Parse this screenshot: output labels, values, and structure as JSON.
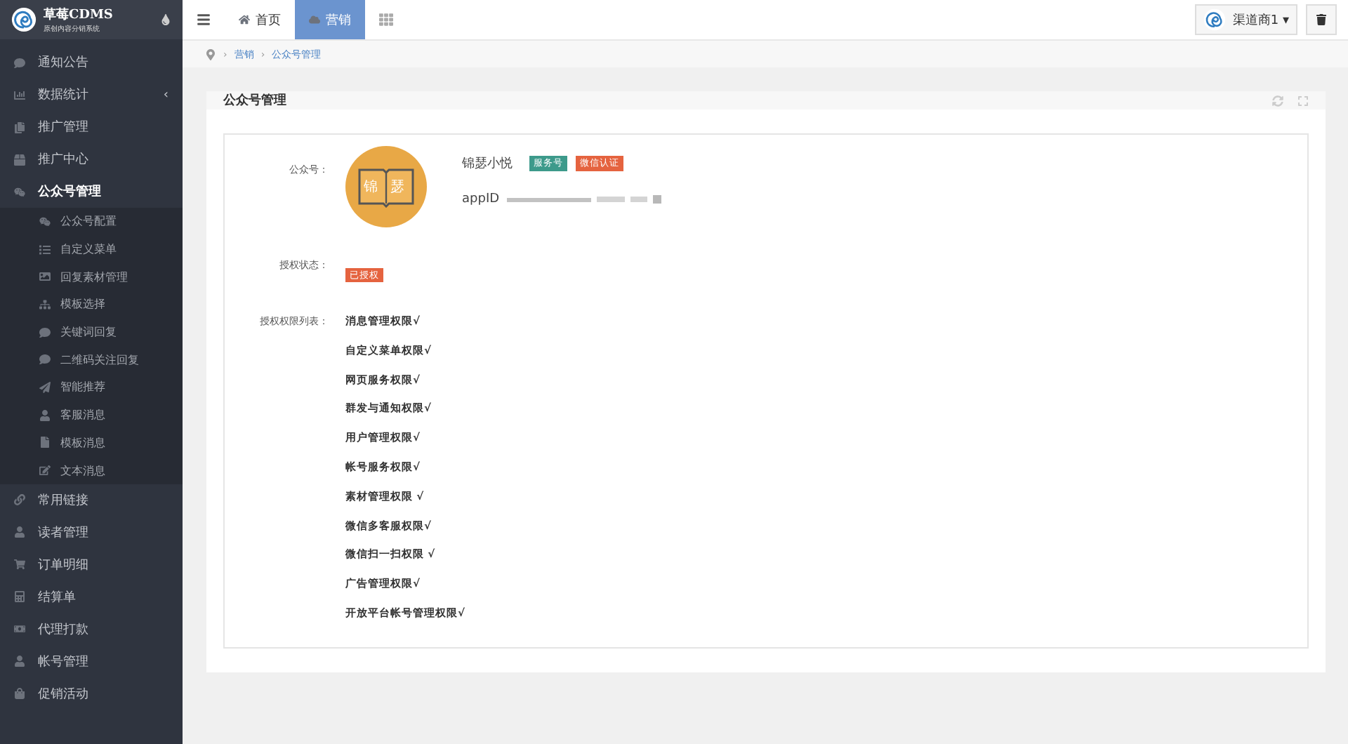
{
  "brand": {
    "title": "草莓CDMS",
    "subtitle": "原创内容分销系统"
  },
  "sidebar": {
    "items": [
      {
        "label": "通知公告",
        "selected": false
      },
      {
        "label": "数据统计",
        "selected": false,
        "caret": "‹"
      },
      {
        "label": "推广管理",
        "selected": false
      },
      {
        "label": "推广中心",
        "selected": false
      },
      {
        "label": "公众号管理",
        "selected": true,
        "children": [
          {
            "label": "公众号配置"
          },
          {
            "label": "自定义菜单"
          },
          {
            "label": "回复素材管理"
          },
          {
            "label": "模板选择"
          },
          {
            "label": "关键词回复"
          },
          {
            "label": "二维码关注回复"
          },
          {
            "label": "智能推荐"
          },
          {
            "label": "客服消息"
          },
          {
            "label": "模板消息"
          },
          {
            "label": "文本消息"
          }
        ]
      },
      {
        "label": "常用链接",
        "selected": false
      },
      {
        "label": "读者管理",
        "selected": false
      },
      {
        "label": "订单明细",
        "selected": false
      },
      {
        "label": "结算单",
        "selected": false
      },
      {
        "label": "代理打款",
        "selected": false
      },
      {
        "label": "帐号管理",
        "selected": false
      },
      {
        "label": "促销活动",
        "selected": false
      }
    ]
  },
  "tabs": [
    {
      "label": "首页",
      "selected": false
    },
    {
      "label": "营销",
      "selected": true
    }
  ],
  "user": {
    "name": "渠道商1",
    "caret": "▾"
  },
  "breadcrumb": {
    "separator": "›",
    "items": [
      "营销",
      "公众号管理"
    ]
  },
  "panel": {
    "title": "公众号管理",
    "account_label": "公众号：",
    "avatar_text": [
      "锦",
      "瑟"
    ],
    "account_name": "锦瑟小悦",
    "badges": [
      {
        "label": "服务号",
        "color": "#3d9a8b"
      },
      {
        "label": "微信认证",
        "color": "#e5633f"
      }
    ],
    "appid_label": "appID",
    "status_label": "授权状态：",
    "status": "已授权",
    "permissions_label": "授权权限列表：",
    "permissions": [
      "消息管理权限√",
      "自定义菜单权限√",
      "网页服务权限√",
      "群发与通知权限√",
      "用户管理权限√",
      "帐号服务权限√",
      "素材管理权限 √",
      "微信多客服权限√",
      "微信扫一扫权限 √",
      "广告管理权限√",
      "开放平台帐号管理权限√"
    ]
  }
}
